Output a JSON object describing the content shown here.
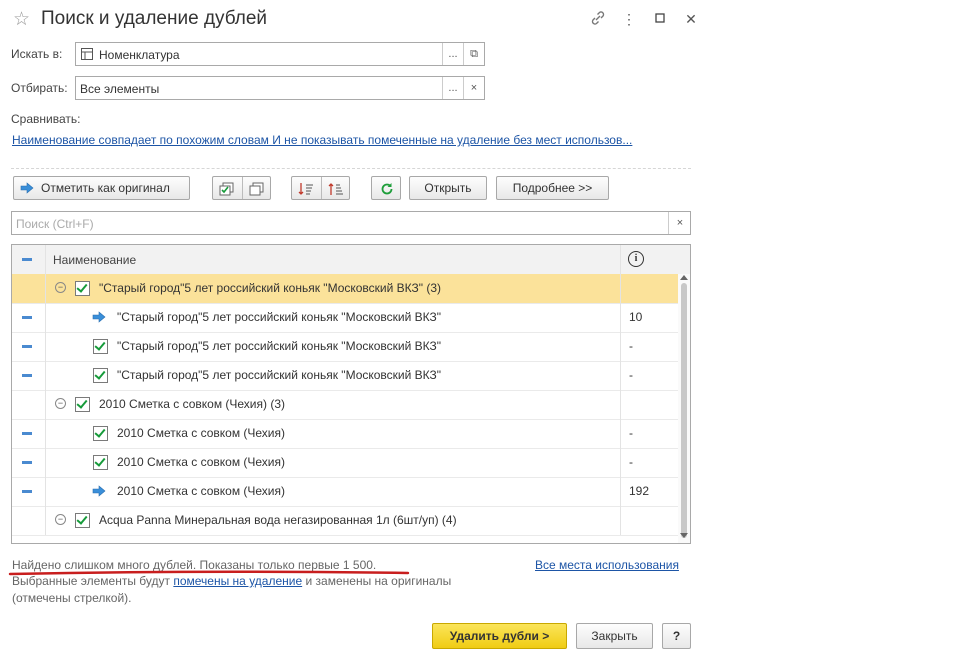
{
  "window": {
    "title": "Поиск и удаление дублей",
    "link_icon": "link-icon",
    "more_icon": "more-vertical-icon",
    "maximize_icon": "maximize-icon",
    "close_icon": "close-icon"
  },
  "form": {
    "search_in_label": "Искать в:",
    "search_in_value": "Номенклатура",
    "filter_label": "Отбирать:",
    "filter_value": "Все элементы",
    "compare_label": "Сравнивать:",
    "compare_link": "Наименование совпадает по похожим словам И не показывать помеченные на удаление без мест использов...",
    "select_btn": "...",
    "open_icon": "⧉",
    "clear_icon": "×"
  },
  "toolbar": {
    "mark_original": "Отметить как оригинал",
    "open": "Открыть",
    "more": "Подробнее >>"
  },
  "search": {
    "placeholder": "Поиск (Ctrl+F)",
    "clear": "×"
  },
  "table": {
    "header_name": "Наименование",
    "header_info": "i",
    "rows": [
      {
        "level": 0,
        "text": "\"Старый город\"5 лет российский коньяк \"Московский ВКЗ\" (3)",
        "value": "",
        "kind": "group"
      },
      {
        "level": 1,
        "text": "\"Старый город\"5 лет российский коньяк \"Московский ВКЗ\"",
        "value": "10",
        "kind": "original"
      },
      {
        "level": 1,
        "text": "\"Старый город\"5 лет российский коньяк \"Московский ВКЗ\"",
        "value": "-",
        "kind": "dup"
      },
      {
        "level": 1,
        "text": "\"Старый город\"5 лет российский коньяк \"Московский ВКЗ\"",
        "value": "-",
        "kind": "dup"
      },
      {
        "level": 0,
        "text": "2010 Сметка с совком (Чехия) (3)",
        "value": "",
        "kind": "group"
      },
      {
        "level": 1,
        "text": "2010 Сметка с совком (Чехия)",
        "value": "-",
        "kind": "dup"
      },
      {
        "level": 1,
        "text": "2010 Сметка с совком (Чехия)",
        "value": "-",
        "kind": "dup"
      },
      {
        "level": 1,
        "text": "2010 Сметка с совком (Чехия)",
        "value": "192",
        "kind": "original"
      },
      {
        "level": 0,
        "text": "Acqua Panna Минеральная вода негазированная 1л (6шт/уп) (4)",
        "value": "",
        "kind": "group"
      }
    ]
  },
  "footer": {
    "too_many": "Найдено слишком много дублей. Показаны только первые 1 500.",
    "all_usages": "Все места использования",
    "note_before": "Выбранные элементы будут",
    "note_link": "помечены на удаление",
    "note_after": "и заменены на оригиналы",
    "note_line2": "(отмечены стрелкой).",
    "delete_btn": "Удалить дубли >",
    "close_btn": "Закрыть",
    "help_btn": "?"
  },
  "colors": {
    "accent_yellow": "#f5d630",
    "selected_row": "#fbe29a",
    "link": "#1d55a6",
    "underline_red": "#c81e1e"
  }
}
